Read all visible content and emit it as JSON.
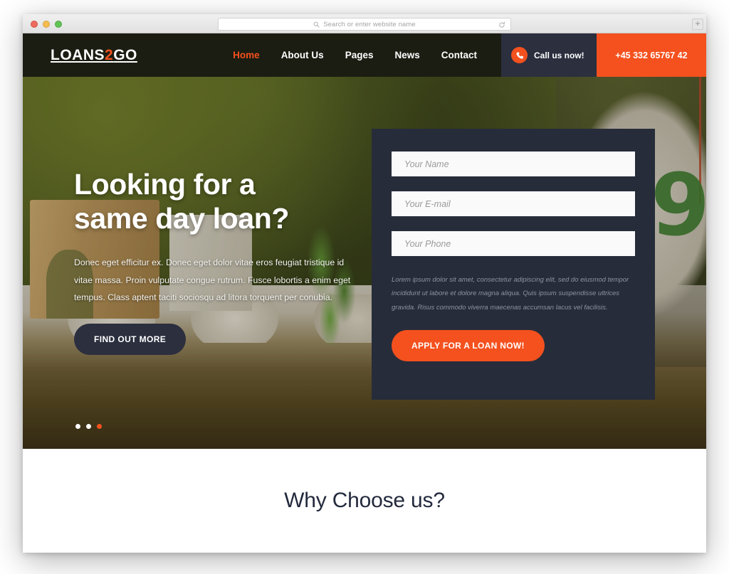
{
  "browser": {
    "traffic_lights": [
      "close",
      "minimize",
      "zoom"
    ],
    "url_placeholder": "Search or enter website name",
    "search_icon": "search-icon",
    "reload_icon": "reload-icon",
    "new_tab_label": "+"
  },
  "header": {
    "logo": {
      "text_main": "LOANS",
      "accent": "2",
      "text_end": "GO"
    },
    "nav": [
      {
        "label": "Home",
        "active": true
      },
      {
        "label": "About Us",
        "active": false
      },
      {
        "label": "Pages",
        "active": false
      },
      {
        "label": "News",
        "active": false
      },
      {
        "label": "Contact",
        "active": false
      }
    ],
    "call_label": "Call us now!",
    "phone_icon": "phone-icon",
    "phone_number": "+45 332 65767 42"
  },
  "hero": {
    "title_line1": "Looking for a",
    "title_line2": "same day loan?",
    "paragraph": "Donec eget efficitur ex. Donec eget dolor vitae eros feugiat tristique id vitae massa. Proin vulputate congue rutrum. Fusce lobortis a enim eget tempus. Class aptent taciti sociosqu ad litora torquent per conubia.",
    "cta_label": "FIND OUT MORE",
    "carousel_dots": 3,
    "carousel_active_index": 2,
    "clock_digit": "9"
  },
  "form": {
    "fields": [
      {
        "name": "name",
        "placeholder": "Your Name",
        "value": ""
      },
      {
        "name": "email",
        "placeholder": "Your E-mail",
        "value": ""
      },
      {
        "name": "phone",
        "placeholder": "Your Phone",
        "value": ""
      }
    ],
    "note": "Lorem ipsum dolor sit amet, consectetur adipiscing elit, sed do eiusmod tempor incididunt ut labore et dolore magna aliqua. Quis ipsum suspendisse ultrices gravida. Risus commodo viverra maecenas accumsan lacus vel facilisis.",
    "submit_label": "APPLY FOR A LOAN NOW!"
  },
  "why_section": {
    "title": "Why Choose us?"
  },
  "colors": {
    "accent_orange": "#f4511e",
    "header_dark": "#1b1d12",
    "panel_navy": "#272c3a",
    "call_navy": "#2b2f3e",
    "heading_navy": "#232a3d"
  }
}
